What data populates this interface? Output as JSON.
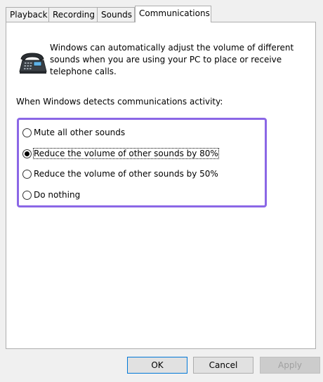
{
  "tabs": [
    {
      "label": "Playback"
    },
    {
      "label": "Recording"
    },
    {
      "label": "Sounds"
    },
    {
      "label": "Communications",
      "active": true
    }
  ],
  "icon": "telephone-icon",
  "intro": {
    "line1": "Windows can automatically adjust the volume of different",
    "line2": "sounds when you are using your PC to place or receive",
    "line3": "telephone calls."
  },
  "prompt": "When Windows detects communications activity:",
  "options": [
    {
      "label": "Mute all other sounds",
      "checked": false
    },
    {
      "label": "Reduce the volume of other sounds by 80%",
      "checked": true
    },
    {
      "label": "Reduce the volume of other sounds by 50%",
      "checked": false
    },
    {
      "label": "Do nothing",
      "checked": false
    }
  ],
  "buttons": {
    "ok": "OK",
    "cancel": "Cancel",
    "apply": "Apply"
  },
  "colors": {
    "highlight": "#8b67e6"
  }
}
